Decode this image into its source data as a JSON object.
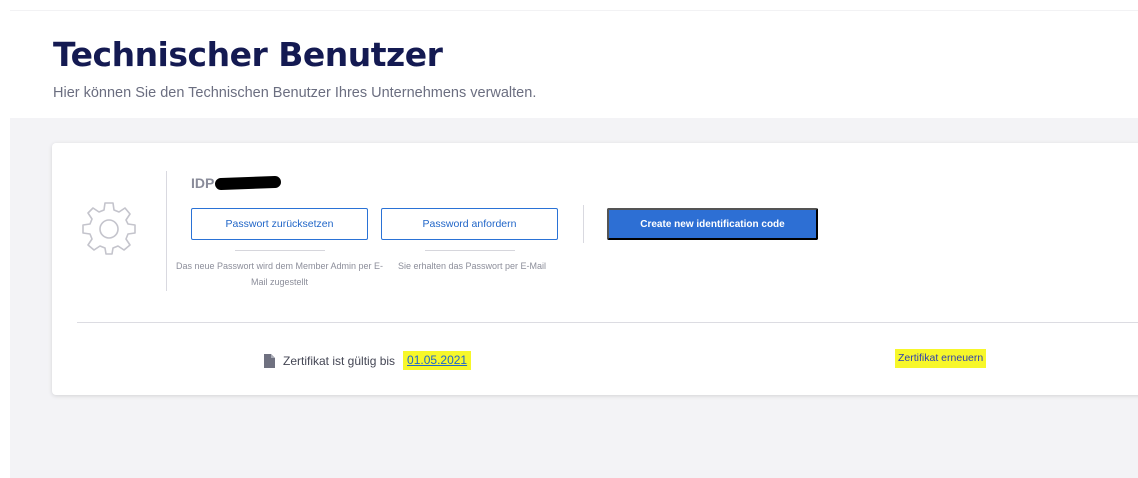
{
  "header": {
    "title": "Technischer Benutzer",
    "subtitle": "Hier können Sie den Technischen Benutzer Ihres Unternehmens verwalten."
  },
  "user_card": {
    "icon": "gear-icon",
    "user_id_prefix": "IDP",
    "reset_password_button": "Passwort zurücksetzen",
    "reset_password_hint": "Das neue Passwort wird dem Member Admin per E-Mail zugestellt",
    "request_password_button": "Password anfordern",
    "request_password_hint": "Sie erhalten das Passwort per E-Mail",
    "create_code_button": "Create new identification code"
  },
  "certificate": {
    "icon": "document-icon",
    "label": "Zertifikat ist gültig bis",
    "valid_until": "01.05.2021",
    "renew_link": "Zertifikat erneuern"
  },
  "colors": {
    "title": "#141a52",
    "primary": "#2d6fd4",
    "highlight": "#f7f72a",
    "background": "#f3f3f6"
  }
}
